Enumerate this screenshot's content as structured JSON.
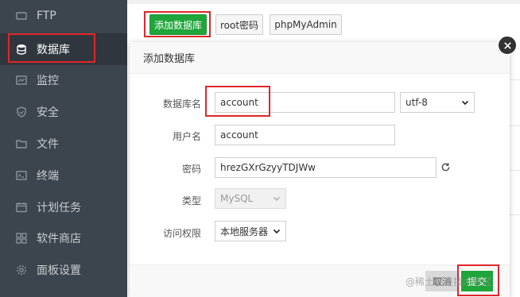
{
  "sidebar": {
    "items": [
      {
        "label": "FTP",
        "icon": "ftp-icon"
      },
      {
        "label": "数据库",
        "icon": "database-icon",
        "active": true
      },
      {
        "label": "监控",
        "icon": "monitor-icon"
      },
      {
        "label": "安全",
        "icon": "shield-icon"
      },
      {
        "label": "文件",
        "icon": "folder-icon"
      },
      {
        "label": "终端",
        "icon": "terminal-icon"
      },
      {
        "label": "计划任务",
        "icon": "calendar-icon"
      },
      {
        "label": "软件商店",
        "icon": "grid-icon"
      },
      {
        "label": "面板设置",
        "icon": "gear-icon"
      }
    ]
  },
  "toolbar": {
    "add_database": "添加数据库",
    "root_password": "root密码",
    "phpmyadmin": "phpMyAdmin"
  },
  "modal": {
    "title": "添加数据库",
    "fields": {
      "db_name_label": "数据库名",
      "db_name_value": "account",
      "charset_value": "utf-8",
      "username_label": "用户名",
      "username_value": "account",
      "password_label": "密码",
      "password_value": "hrezGXrGzyyTDJWw",
      "type_label": "类型",
      "type_value": "MySQL",
      "access_label": "访问权限",
      "access_value": "本地服务器"
    },
    "cancel_label": "取消",
    "submit_label": "提交"
  },
  "watermark": "@稀土掘金技术社区",
  "colors": {
    "sidebar_bg": "#3c444d",
    "accent_green": "#20a53a",
    "highlight_red": "#e0262a"
  }
}
